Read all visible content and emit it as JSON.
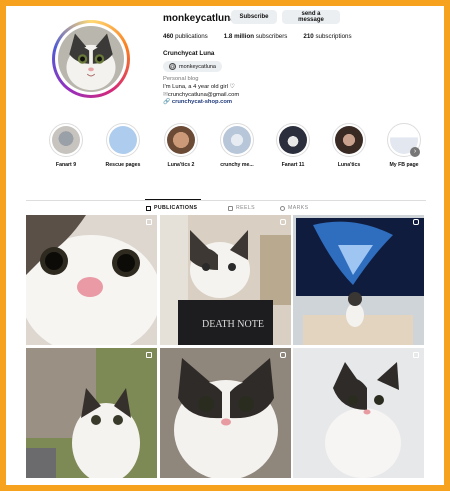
{
  "profile": {
    "username": "monkeycatluna",
    "subscribe_label": "Subscribe",
    "message_label": "send a message",
    "stats": [
      {
        "count": "460",
        "label": "publications"
      },
      {
        "count": "1.8 million",
        "label": "subscribers"
      },
      {
        "count": "210",
        "label": "subscriptions"
      }
    ],
    "display_name": "Crunchycat Luna",
    "threads_tag": "monkeycatluna",
    "category": "Personal blog",
    "bio_line1": "I'm Luna, a 4 year old girl ♡",
    "bio_email": "crunchycatluna@gmail.com",
    "bio_link": "crunchycat-shop.com"
  },
  "highlights": [
    {
      "label": "Fanart 9"
    },
    {
      "label": "Rescue pages"
    },
    {
      "label": "Luna'tics 2"
    },
    {
      "label": "crunchy me..."
    },
    {
      "label": "Fanart 11"
    },
    {
      "label": "Luna'tics"
    },
    {
      "label": "My FB page"
    }
  ],
  "tabs": [
    {
      "label": "PUBLICATIONS",
      "active": true
    },
    {
      "label": "REELS",
      "active": false
    },
    {
      "label": "MARKS",
      "active": false
    }
  ],
  "colors": {
    "frame": "#f6a21e",
    "link": "#1f3a7a",
    "button_bg": "#eceff2"
  }
}
